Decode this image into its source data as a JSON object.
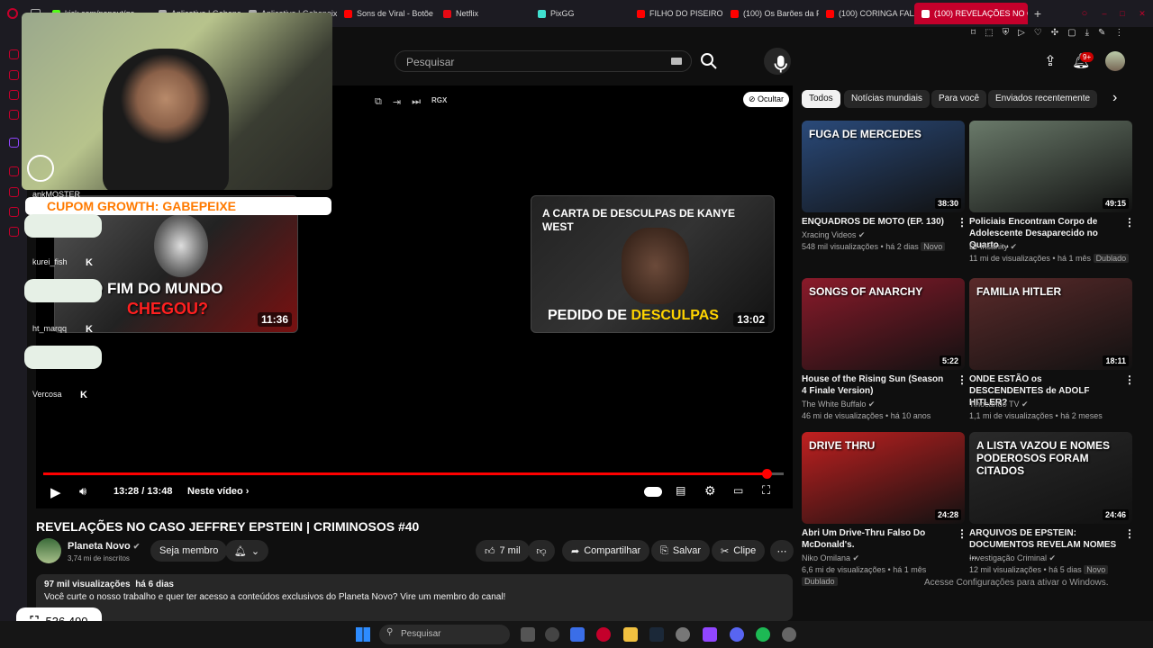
{
  "browser_tabs": [
    {
      "label": "kick.com/popout/ga",
      "color": "#53fc18"
    },
    {
      "label": "Aplicativo | Gabepeix",
      "color": "#cccccc"
    },
    {
      "label": "Aplicativo | Gabepeix",
      "color": "#cccccc"
    },
    {
      "label": "Sons de Viral - Botõe",
      "color": "#ff0000"
    },
    {
      "label": "Netflix",
      "color": "#e50914"
    },
    {
      "label": "PixGG",
      "color": "#40e0d0"
    },
    {
      "label": "FILHO DO PISEIRO E",
      "color": "#ff0000"
    },
    {
      "label": "(100) Os Barões da P",
      "color": "#ff0000"
    },
    {
      "label": "(100) CORINGA FALA",
      "color": "#ff0000"
    },
    {
      "label": "(100) REVELAÇÕES NO CA",
      "color": "#ff0000",
      "active": true
    }
  ],
  "header": {
    "search_placeholder": "Pesquisar",
    "notif_badge": "9+"
  },
  "player": {
    "ocultar": "Ocultar",
    "rgx": "RGX",
    "time": "13:28 / 13:48",
    "neste_video": "Neste vídeo",
    "progress": 0.977,
    "end_cards": [
      {
        "title_top": "O FIM DO MUNDO",
        "title_bottom": "CHEGOU?",
        "duration": "11:36"
      },
      {
        "title_top": "A CARTA DE DESCULPAS DE KANYE WEST",
        "title_bottom_a": "PEDIDO DE",
        "title_bottom_b": "DESCULPAS",
        "duration": "13:02"
      }
    ]
  },
  "overlay": {
    "coupon": "CUPOM GROWTH: GABEPEIXE",
    "chat_users": [
      "ankMOSTER",
      "kurei_fish",
      "ht_marqq",
      "Vercosa"
    ],
    "counter": "536.490"
  },
  "video": {
    "title": "REVELAÇÕES NO CASO JEFFREY EPSTEIN | CRIMINOSOS #40",
    "channel": "Planeta Novo",
    "subscribers": "3,74 mi de inscritos",
    "join": "Seja membro",
    "likes": "7 mil",
    "share": "Compartilhar",
    "save": "Salvar",
    "clip": "Clipe",
    "views": "97 mil visualizações",
    "age": "há 6 dias",
    "description": "Você curte o nosso trabalho e quer ter acesso a conteúdos exclusivos do Planeta Novo? Vire um membro do canal!"
  },
  "chips": [
    "Todos",
    "Notícias mundiais",
    "Para você",
    "Enviados recentemente"
  ],
  "recommendations": [
    {
      "title": "ENQUADROS DE MOTO (EP. 130)",
      "channel": "Xracing Videos",
      "meta": "548 mil visualizações • há 2 dias",
      "tag": "Novo",
      "duration": "38:30",
      "thumb_text": "FUGA DE MERCEDES",
      "bg": "#2a4a7a"
    },
    {
      "title": "Policiais Encontram Corpo de Adolescente Desaparecido no Quarto ...",
      "channel": "Dr Insanity",
      "meta": "11 mi de visualizações • há 1 mês",
      "tag": "Dublado",
      "duration": "49:15",
      "thumb_text": "",
      "bg": "#6a7a6a"
    },
    {
      "title": "House of the Rising Sun (Season 4 Finale Version)",
      "channel": "The White Buffalo",
      "meta": "46 mi de visualizações • há 10 anos",
      "tag": "",
      "duration": "5:22",
      "thumb_text": "SONGS OF ANARCHY",
      "bg": "#8a1a2a"
    },
    {
      "title": "ONDE ESTÃO os DESCENDENTES de ADOLF HITLER?",
      "channel": "Tinocando TV",
      "meta": "1,1 mi de visualizações • há 2 meses",
      "tag": "",
      "duration": "18:11",
      "thumb_text": "FAMILIA HITLER",
      "bg": "#5a2a2a"
    },
    {
      "title": "Abri Um Drive-Thru Falso Do McDonald's.",
      "channel": "Niko Omilana",
      "meta": "6,6 mi de visualizações • há 1 mês",
      "tag": "Dublado",
      "duration": "24:28",
      "thumb_text": "DRIVE THRU",
      "bg": "#c02020"
    },
    {
      "title": "ARQUIVOS DE EPSTEIN: DOCUMENTOS REVELAM NOMES ...",
      "channel": "Investigação Criminal",
      "meta": "12 mil visualizações • há 5 dias",
      "tag": "Novo",
      "duration": "24:46",
      "thumb_text": "A LISTA VAZOU E NOMES PODEROSOS FORAM CITADOS",
      "bg": "#2a2a2a"
    }
  ],
  "activation_notice": "Acesse Configurações para ativar o Windows.",
  "taskbar": {
    "search": "Pesquisar"
  }
}
